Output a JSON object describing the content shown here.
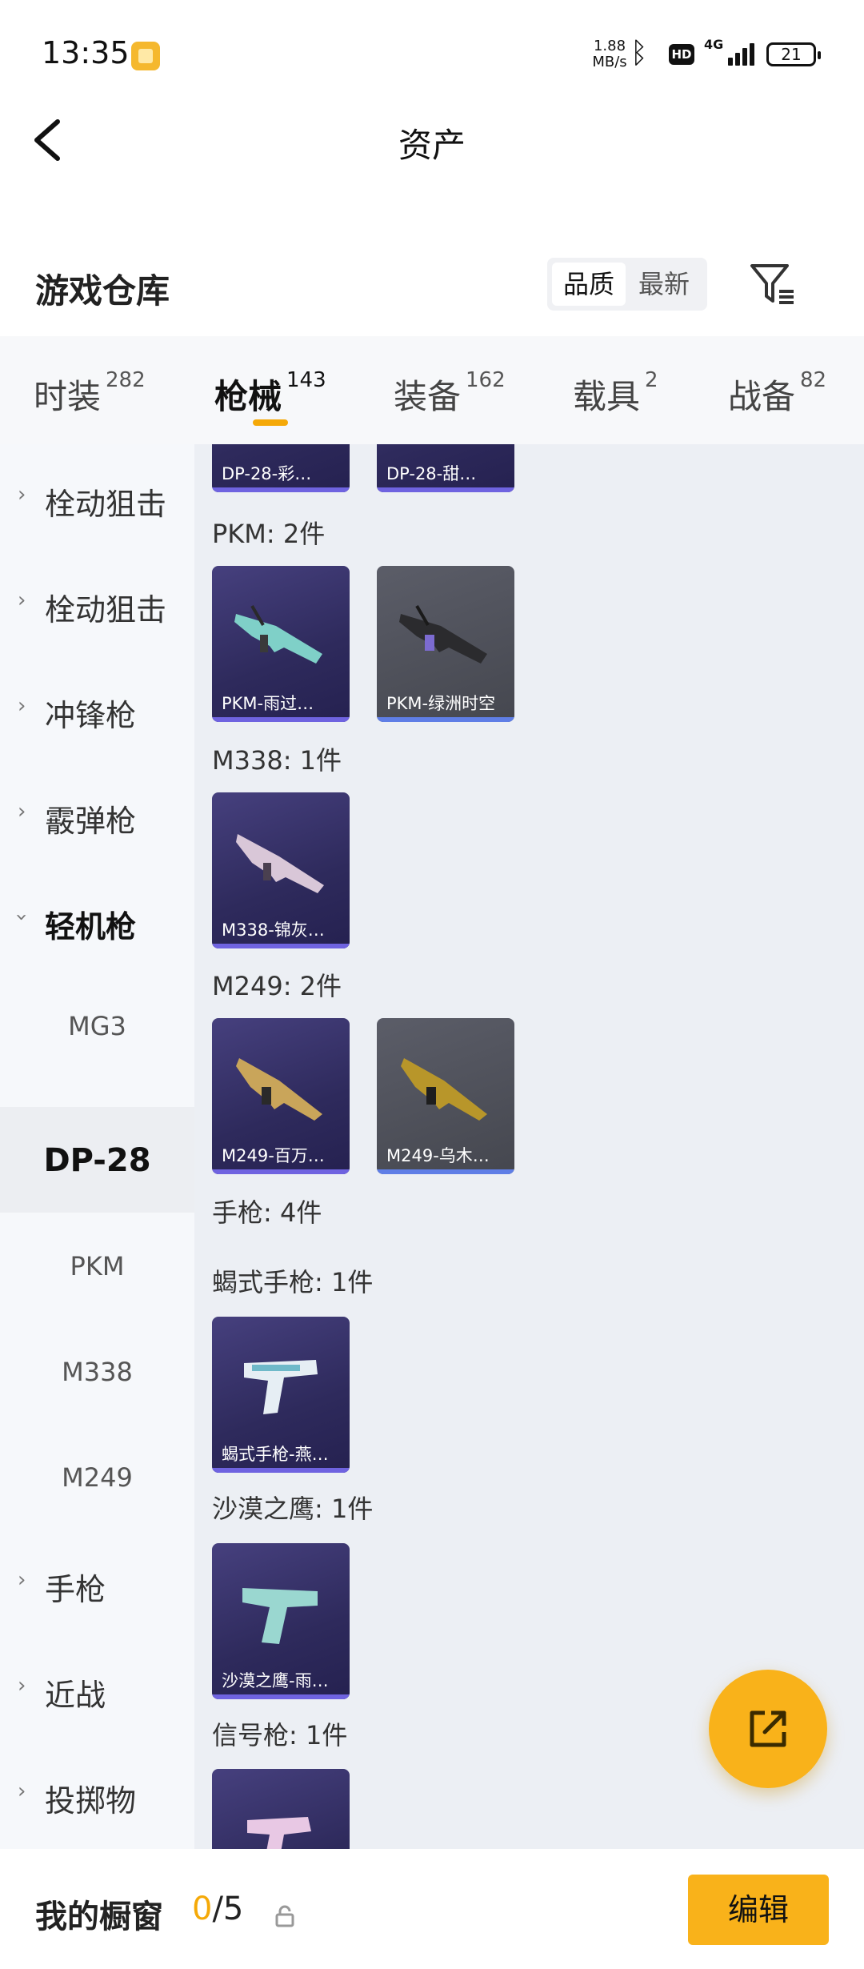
{
  "status_bar": {
    "time": "13:35",
    "net_speed_value": "1.88",
    "net_speed_unit": "MB/s",
    "hd_badge": "HD",
    "network_type": "4G",
    "battery": "21"
  },
  "header": {
    "title": "资产"
  },
  "section": {
    "title": "游戏仓库",
    "sort_options": [
      "品质",
      "最新"
    ],
    "active_sort": "品质"
  },
  "tabs": [
    {
      "label": "时装",
      "count": "282"
    },
    {
      "label": "枪械",
      "count": "143",
      "active": true
    },
    {
      "label": "装备",
      "count": "162"
    },
    {
      "label": "载具",
      "count": "2"
    },
    {
      "label": "战备",
      "count": "82"
    }
  ],
  "sidebar": {
    "items": [
      {
        "label": "栓动狙击",
        "type": "category"
      },
      {
        "label": "栓动狙击",
        "type": "category"
      },
      {
        "label": "冲锋枪",
        "type": "category"
      },
      {
        "label": "霰弹枪",
        "type": "category"
      },
      {
        "label": "轻机枪",
        "type": "category",
        "expanded": true
      },
      {
        "label": "MG3",
        "type": "sub"
      },
      {
        "label": "DP-28",
        "type": "sub",
        "selected": true
      },
      {
        "label": "PKM",
        "type": "sub"
      },
      {
        "label": "M338",
        "type": "sub"
      },
      {
        "label": "M249",
        "type": "sub"
      },
      {
        "label": "手枪",
        "type": "category"
      },
      {
        "label": "近战",
        "type": "category"
      },
      {
        "label": "投掷物",
        "type": "category"
      }
    ]
  },
  "content": {
    "top_cards": [
      "DP-28-彩…",
      "DP-28-甜…"
    ],
    "groups": [
      {
        "label": "PKM: 2件",
        "cards": [
          {
            "name": "PKM-雨过…",
            "rarity": "purple"
          },
          {
            "name": "PKM-绿洲时空",
            "rarity": "gray"
          }
        ]
      },
      {
        "label": "M338: 1件",
        "cards": [
          {
            "name": "M338-锦灰…",
            "rarity": "purple"
          }
        ]
      },
      {
        "label": "M249: 2件",
        "cards": [
          {
            "name": "M249-百万…",
            "rarity": "purple"
          },
          {
            "name": "M249-乌木…",
            "rarity": "gray"
          }
        ]
      },
      {
        "label": "手枪: 4件",
        "cards": []
      },
      {
        "label": "蝎式手枪: 1件",
        "cards": [
          {
            "name": "蝎式手枪-燕…",
            "rarity": "purple"
          }
        ]
      },
      {
        "label": "沙漠之鹰: 1件",
        "cards": [
          {
            "name": "沙漠之鹰-雨…",
            "rarity": "purple"
          }
        ]
      },
      {
        "label": "信号枪: 1件",
        "cards": [
          {
            "name": "",
            "rarity": "purple"
          }
        ]
      }
    ]
  },
  "bottom_bar": {
    "label": "我的橱窗",
    "current": "0",
    "total": "/5",
    "edit_label": "编辑"
  },
  "colors": {
    "accent": "#f9b21a",
    "rare_purple": "#2e2a5c",
    "common_gray": "#45474f"
  }
}
